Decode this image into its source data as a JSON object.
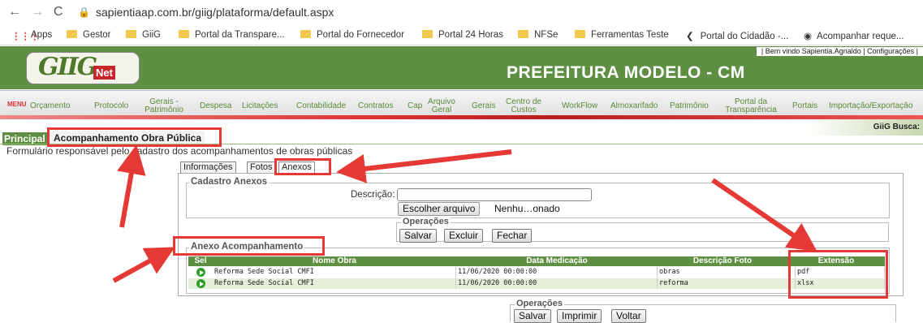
{
  "browser": {
    "url": "sapientiaap.com.br/giig/plataforma/default.aspx",
    "bookmarks": [
      "Apps",
      "Gestor",
      "GiiG",
      "Portal da Transpare...",
      "Portal do Fornecedor",
      "Portal 24 Horas",
      "NFSe",
      "Ferramentas Teste",
      "Portal do Cidadão -...",
      "Acompanhar reque..."
    ]
  },
  "header": {
    "welcome": "| Bem vindo Sapientia.Agnaldo | Configurações |",
    "logo_main": "GIIG",
    "logo_sub": "Net",
    "title": "PREFEITURA MODELO - CM"
  },
  "menu": {
    "label": "MENU",
    "items": [
      "Orçamento",
      "Protocolo",
      "Gerais - Patrimônio",
      "Despesa",
      "Licitações",
      "Contabilidade",
      "Contratos",
      "Cap",
      "Arquivo Geral",
      "Gerais",
      "Centro de Custos",
      "WorkFlow",
      "Almoxarifado",
      "Patrimônio",
      "Portal da Transparência",
      "Portais",
      "Importação/Exportação"
    ],
    "search_label": "GiiG Busca:"
  },
  "breadcrumb": {
    "root": "Principal",
    "page": "Acompanhamento Obra Pública"
  },
  "description": "Formulário responsável pelo cadastro dos acompanhamentos de obras públicas",
  "tabs": [
    "Informações",
    "Fotos",
    "Anexos"
  ],
  "cadastro": {
    "legend": "Cadastro Anexos",
    "descricao_label": "Descrição:",
    "descricao_value": "",
    "file_button": "Escolher arquivo",
    "file_status": "Nenhu…onado"
  },
  "operacoes1": {
    "legend": "Operações",
    "buttons": [
      "Salvar",
      "Excluir",
      "Fechar"
    ]
  },
  "anexo": {
    "legend": "Anexo Acompanhamento",
    "columns": [
      "Sel",
      "Nome Obra",
      "Data Medicação",
      "Descrição Foto",
      "Extensão"
    ],
    "rows": [
      {
        "nome": "Reforma Sede Social CMFI",
        "data": "11/06/2020 00:00:00",
        "descricao": "obras",
        "extensao": "pdf"
      },
      {
        "nome": "Reforma Sede Social CMFI",
        "data": "11/06/2020 00:00:00",
        "descricao": "reforma",
        "extensao": "xlsx"
      }
    ]
  },
  "operacoes2": {
    "legend": "Operações",
    "buttons": [
      "Salvar",
      "Imprimir",
      "Voltar"
    ]
  },
  "colors": {
    "brand_green": "#5e8f42",
    "annotation_red": "#e53935",
    "row_alt": "#e6efd9"
  }
}
